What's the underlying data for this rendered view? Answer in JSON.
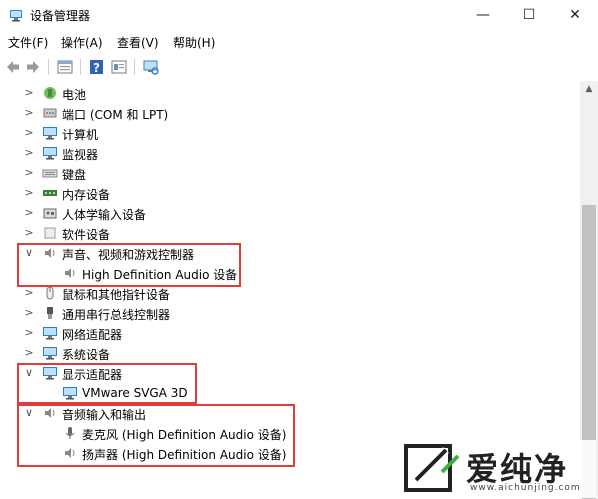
{
  "window": {
    "title": "设备管理器",
    "minimize": "—",
    "maximize": "☐",
    "close": "✕"
  },
  "menubar": [
    {
      "label": "文件(F)"
    },
    {
      "label": "操作(A)"
    },
    {
      "label": "查看(V)"
    },
    {
      "label": "帮助(H)"
    }
  ],
  "toolbar": [
    {
      "name": "back-icon"
    },
    {
      "name": "forward-icon"
    },
    {
      "name": "properties-icon"
    },
    {
      "name": "help-icon"
    },
    {
      "name": "update-driver-icon"
    },
    {
      "name": "scan-hardware-icon"
    }
  ],
  "tree": [
    {
      "label": "电池",
      "expander": ">",
      "icon": "battery-icon",
      "color": "#4a8a3a"
    },
    {
      "label": "端口 (COM 和 LPT)",
      "expander": ">",
      "icon": "port-icon",
      "color": "#7a7a7a"
    },
    {
      "label": "计算机",
      "expander": ">",
      "icon": "computer-icon",
      "color": "#2b7fd1"
    },
    {
      "label": "监视器",
      "expander": ">",
      "icon": "monitor-icon",
      "color": "#2b7fd1"
    },
    {
      "label": "键盘",
      "expander": ">",
      "icon": "keyboard-icon",
      "color": "#8a8a8a"
    },
    {
      "label": "内存设备",
      "expander": ">",
      "icon": "memory-icon",
      "color": "#3f7d3a"
    },
    {
      "label": "人体学输入设备",
      "expander": ">",
      "icon": "hid-icon",
      "color": "#666666"
    },
    {
      "label": "软件设备",
      "expander": ">",
      "icon": "software-device-icon",
      "color": "#9a9a9a"
    },
    {
      "label": "声音、视频和游戏控制器",
      "expander": "∨",
      "icon": "speaker-icon",
      "color": "#888888"
    },
    {
      "label": "High Definition Audio 设备",
      "expander": "",
      "icon": "speaker-icon",
      "color": "#888888",
      "child": true
    },
    {
      "label": "鼠标和其他指针设备",
      "expander": ">",
      "icon": "mouse-icon",
      "color": "#7a7a7a"
    },
    {
      "label": "通用串行总线控制器",
      "expander": ">",
      "icon": "usb-icon",
      "color": "#555555"
    },
    {
      "label": "网络适配器",
      "expander": ">",
      "icon": "network-adapter-icon",
      "color": "#2b7fd1"
    },
    {
      "label": "系统设备",
      "expander": ">",
      "icon": "system-device-icon",
      "color": "#2b7fd1"
    },
    {
      "label": "显示适配器",
      "expander": "∨",
      "icon": "display-adapter-icon",
      "color": "#2b7fd1"
    },
    {
      "label": "VMware SVGA 3D",
      "expander": "",
      "icon": "display-adapter-icon",
      "color": "#2b7fd1",
      "child": true
    },
    {
      "label": "音频输入和输出",
      "expander": "∨",
      "icon": "speaker-icon",
      "color": "#888888"
    },
    {
      "label": "麦克风 (High Definition Audio 设备)",
      "expander": "",
      "icon": "microphone-icon",
      "color": "#666666",
      "child": true
    },
    {
      "label": "扬声器 (High Definition Audio 设备)",
      "expander": "",
      "icon": "speaker-icon",
      "color": "#888888",
      "child": true
    }
  ],
  "highlight_color": "#e03c3c",
  "watermark": {
    "text": "爱纯净",
    "url": "www.aichunjing.com"
  }
}
